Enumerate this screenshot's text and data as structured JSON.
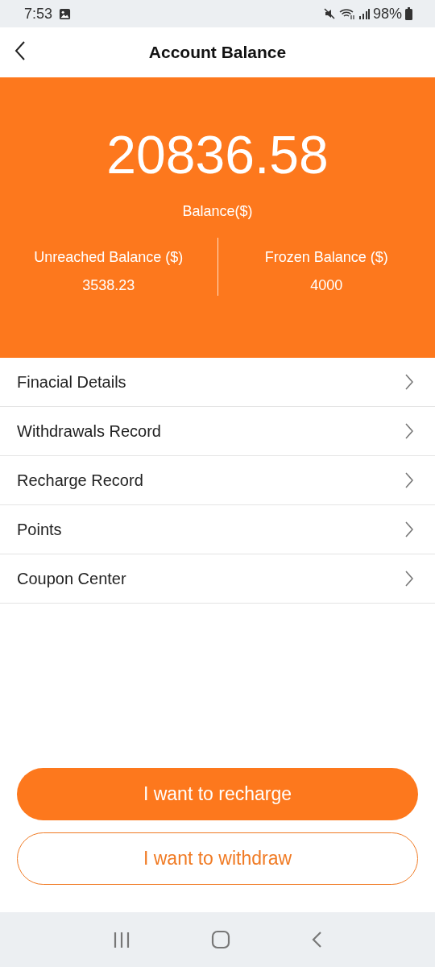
{
  "status_bar": {
    "time": "7:53",
    "battery": "98%"
  },
  "header": {
    "title": "Account Balance"
  },
  "balance": {
    "amount": "20836.58",
    "label": "Balance($)"
  },
  "sub_balances": [
    {
      "label": "Unreached Balance ($)",
      "value": "3538.23"
    },
    {
      "label": "Frozen Balance ($)",
      "value": "4000"
    }
  ],
  "menu": [
    "Finacial Details",
    "Withdrawals Record",
    "Recharge Record",
    "Points",
    "Coupon Center"
  ],
  "buttons": [
    {
      "label": "I want to recharge",
      "kind": "filled"
    },
    {
      "label": "I want to withdraw",
      "kind": "outline"
    }
  ]
}
